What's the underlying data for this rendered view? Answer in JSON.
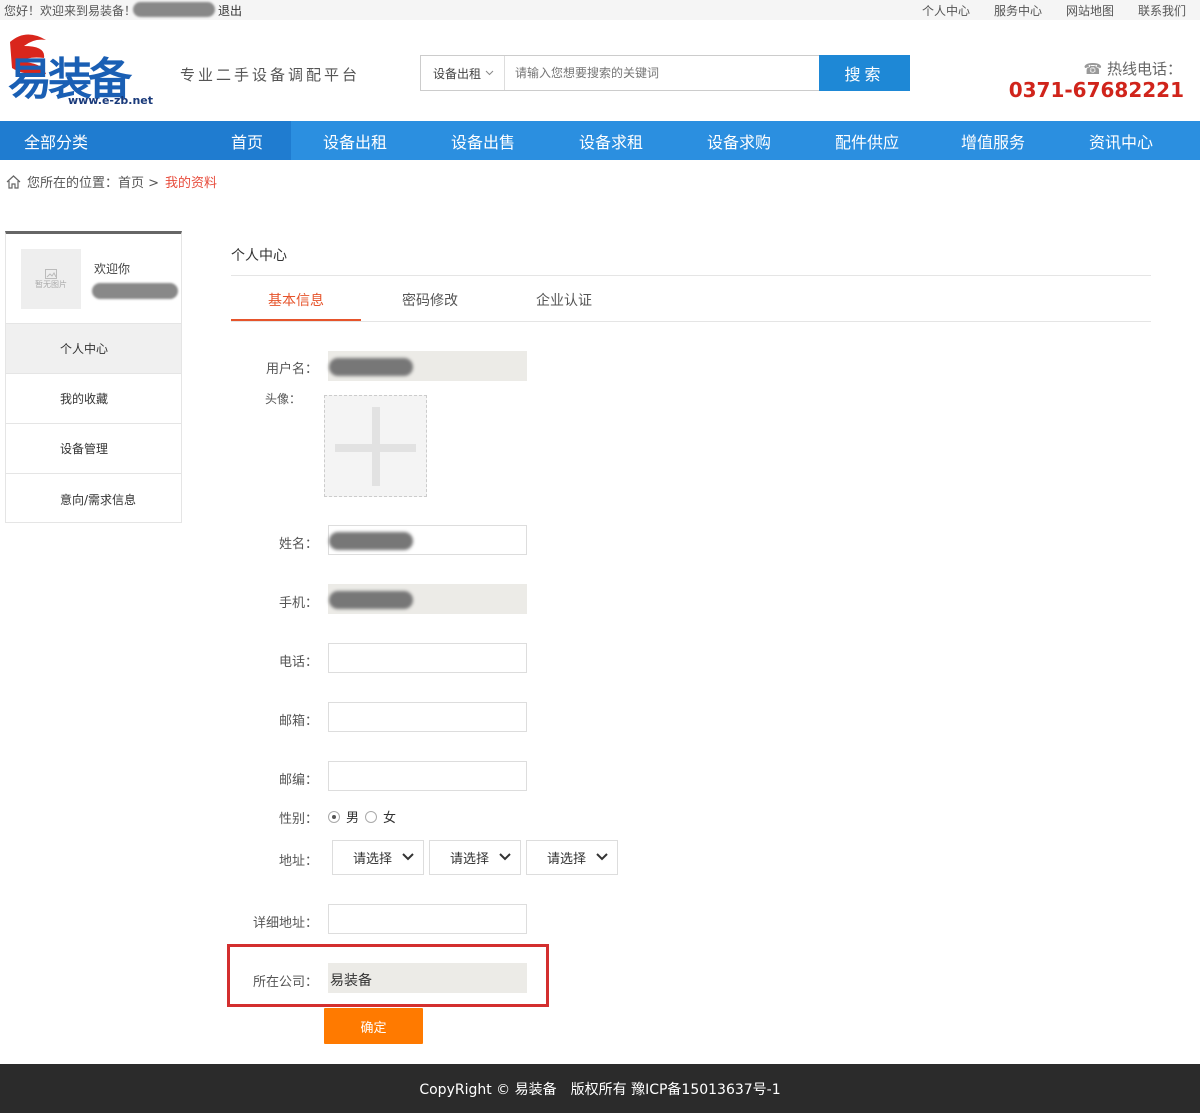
{
  "topbar": {
    "greeting": "您好！欢迎来到易装备！",
    "logout": "退出",
    "links": [
      "个人中心",
      "服务中心",
      "网站地图",
      "联系我们"
    ]
  },
  "header": {
    "logo_text": "易装备",
    "logo_url_text": "www.e-zb.net",
    "slogan": "专业二手设备调配平台",
    "search_category": "设备出租",
    "search_placeholder": "请输入您想要搜索的关键词",
    "search_button": "搜索",
    "hotline_label": "热线电话：",
    "hotline_number": "0371-67682221"
  },
  "nav": {
    "all": "全部分类",
    "items": [
      "首页",
      "设备出租",
      "设备出售",
      "设备求租",
      "设备求购",
      "配件供应",
      "增值服务",
      "资讯中心"
    ]
  },
  "breadcrumb": {
    "prefix": "您所在的位置：首页 >",
    "current": "我的资料"
  },
  "sidebar": {
    "avatar_placeholder": "暂无图片",
    "welcome": "欢迎你",
    "menu": [
      "个人中心",
      "我的收藏",
      "设备管理",
      "意向/需求信息"
    ]
  },
  "main": {
    "title": "个人中心",
    "tabs": [
      "基本信息",
      "密码修改",
      "企业认证"
    ],
    "form": {
      "username_label": "用户名：",
      "avatar_label": "头像：",
      "name_label": "姓名：",
      "mobile_label": "手机：",
      "phone_label": "电话：",
      "email_label": "邮箱：",
      "postcode_label": "邮编：",
      "gender_label": "性别：",
      "gender_male": "男",
      "gender_female": "女",
      "address_label": "地址：",
      "address_selects": [
        "请选择",
        "请选择",
        "请选择"
      ],
      "detail_address_label": "详细地址：",
      "company_label": "所在公司：",
      "company_value": "易装备",
      "submit": "确定"
    }
  },
  "footer": {
    "text": "CopyRight © 易装备　版权所有 豫ICP备15013637号-1"
  },
  "colors": {
    "nav_blue": "#2b8fe0",
    "accent_orange": "#e6542b",
    "hotline_red": "#d0241b",
    "submit_orange": "#ff7a00",
    "highlight_red": "#d32f2f"
  }
}
